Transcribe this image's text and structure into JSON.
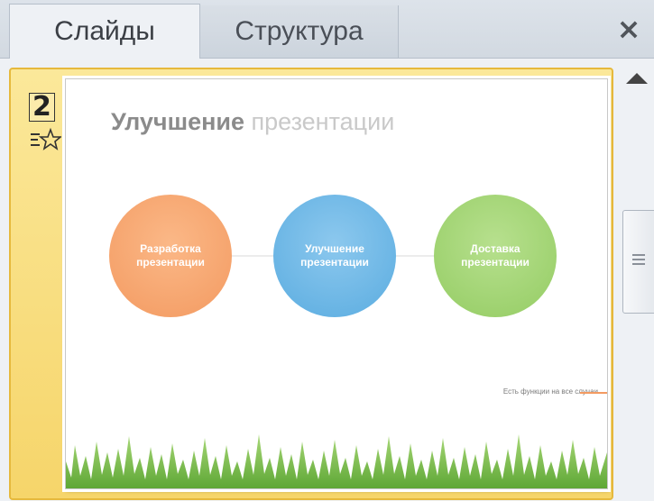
{
  "tabs": [
    {
      "label": "Слайды",
      "active": true
    },
    {
      "label": "Структура",
      "active": false
    }
  ],
  "close_icon": "×",
  "slide_panel": {
    "selected_slide_number": "2",
    "animation_icon": "slide-animation-star-icon"
  },
  "slide": {
    "title_bold": "Улучшение",
    "title_light": " презентации",
    "circles": [
      {
        "line1": "Разработка",
        "line2": "презентации",
        "color": "#f39a61"
      },
      {
        "line1": "Улучшение",
        "line2": "презентации",
        "color": "#5aace0"
      },
      {
        "line1": "Доставка",
        "line2": "презентации",
        "color": "#94cc63"
      }
    ],
    "footnote": "Есть функции на все случаи"
  },
  "colors": {
    "selection_fill": "#f6d56a",
    "selection_border": "#e6b93c",
    "grass": "#7bbf4a"
  }
}
